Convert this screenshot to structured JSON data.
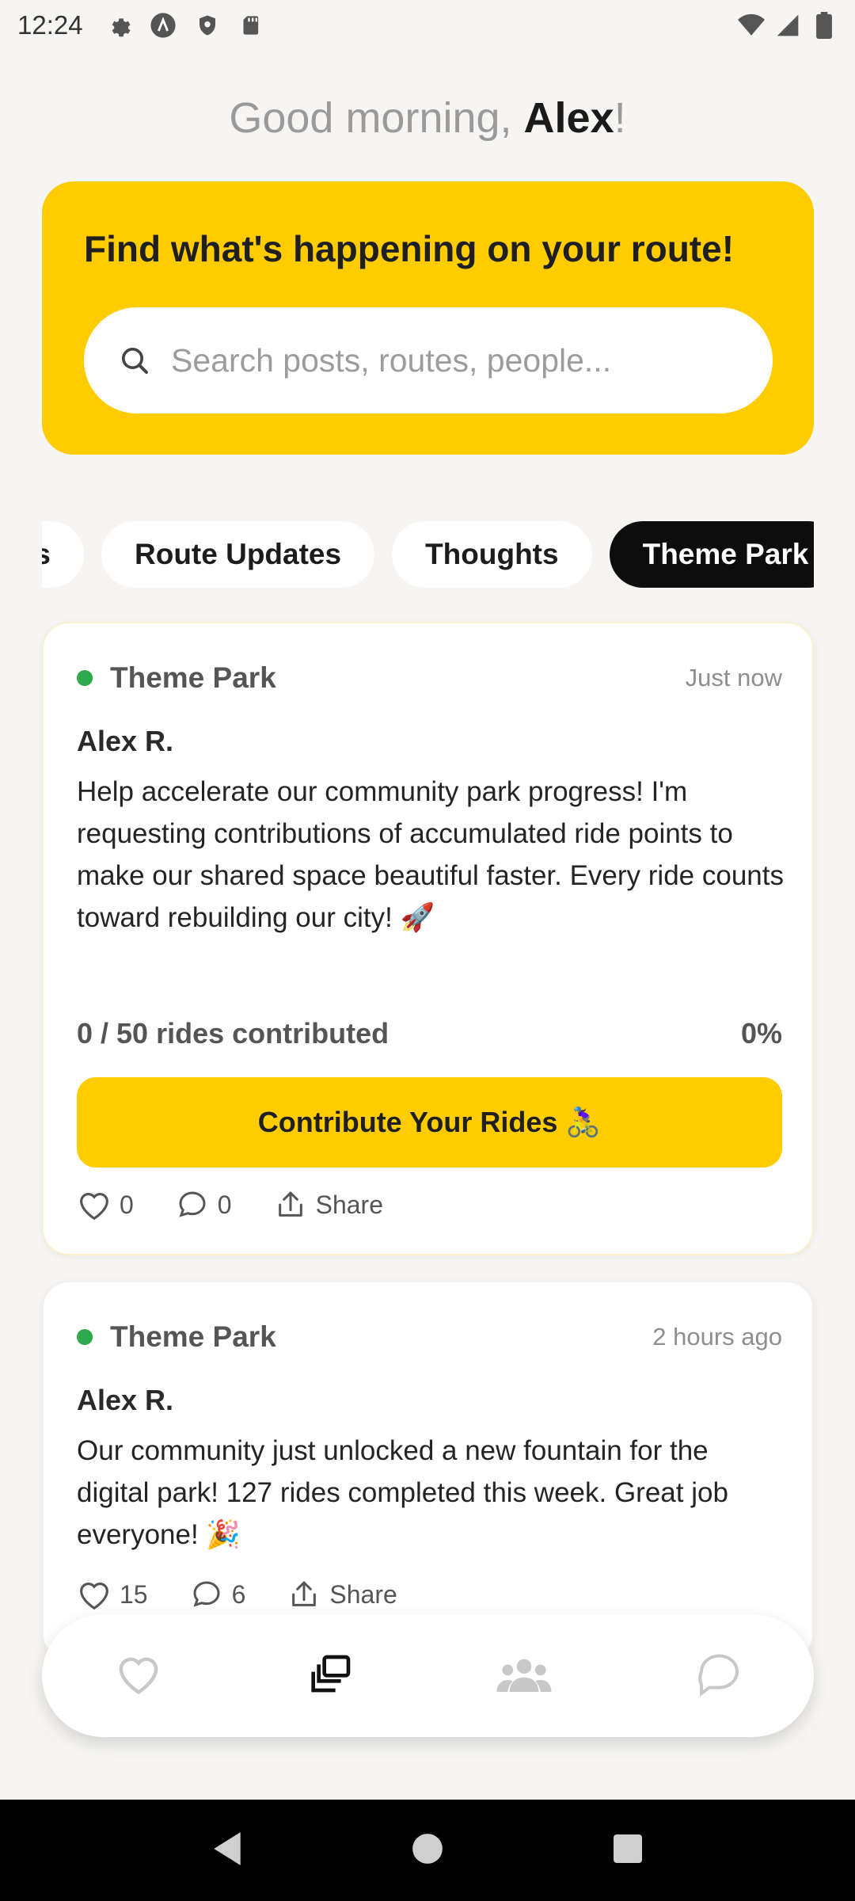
{
  "status_bar": {
    "time": "12:24",
    "left_icons": [
      "gear-icon",
      "a-circle-icon",
      "shield-icon",
      "sd-card-icon"
    ],
    "right_icons": [
      "wifi-icon",
      "signal-icon",
      "battery-icon"
    ]
  },
  "greeting": {
    "prefix": "Good morning, ",
    "name": "Alex",
    "suffix": "!"
  },
  "hero": {
    "title": "Find what's happening on your route!",
    "search_placeholder": "Search posts, routes, people..."
  },
  "chips": [
    {
      "label": "s",
      "active": false
    },
    {
      "label": "Route Updates",
      "active": false
    },
    {
      "label": "Thoughts",
      "active": false
    },
    {
      "label": "Theme Park",
      "active": true
    }
  ],
  "posts": [
    {
      "category": "Theme Park",
      "time": "Just now",
      "author": "Alex R.",
      "body": "Help accelerate our community park progress! I'm requesting contributions of accumulated ride points to make our shared space beautiful faster. Every ride counts toward rebuilding our city! 🚀",
      "progress_text": "0 / 50 rides contributed",
      "progress_pct": "0%",
      "cta_label": "Contribute Your Rides 🚴‍♀️",
      "likes": "0",
      "comments": "0",
      "share": "Share"
    },
    {
      "category": "Theme Park",
      "time": "2 hours ago",
      "author": "Alex R.",
      "body": "Our community just unlocked a new fountain for the digital park! 127 rides completed this week. Great job everyone! 🎉",
      "likes": "15",
      "comments": "6",
      "share": "Share"
    }
  ],
  "bottom_nav": [
    "heart-icon",
    "feed-icon",
    "community-icon",
    "chat-icon"
  ],
  "colors": {
    "accent": "#ffcc00",
    "status_dot": "#2eaa4a",
    "background": "#f6f5f3"
  }
}
